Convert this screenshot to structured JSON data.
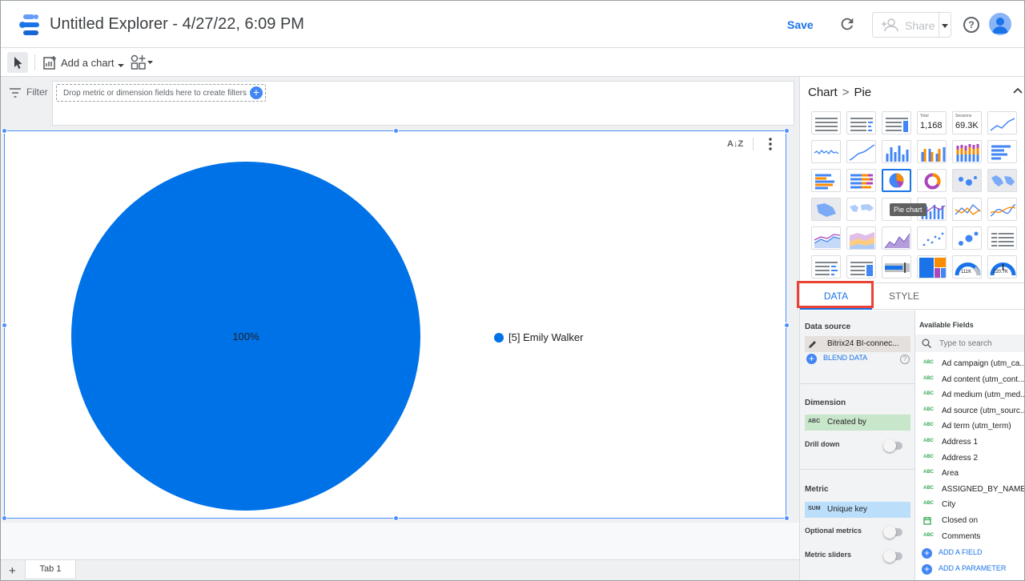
{
  "app": {
    "title": "Untitled Explorer - 4/27/22, 6:09 PM",
    "save_label": "Save",
    "share_label": "Share",
    "help_glyph": "?"
  },
  "toolbar": {
    "add_chart_label": "Add a chart"
  },
  "filter": {
    "label": "Filter",
    "placeholder": "Drop metric or dimension fields here to create filters"
  },
  "chart": {
    "sort_glyph": "A↓Z"
  },
  "chart_data": {
    "type": "pie",
    "slices": [
      {
        "label": "[5] Emily Walker",
        "value": 100,
        "display": "100%",
        "color": "#0072e8"
      }
    ]
  },
  "tabs": [
    {
      "label": "Tab 1"
    }
  ],
  "tab_add_glyph": "+",
  "panel": {
    "breadcrumb_root": "Chart",
    "breadcrumb_sep": ">",
    "breadcrumb_current": "Pie",
    "thumb_total_caption": "Total",
    "thumb_total_value": "1,168",
    "thumb_sessions_caption": "Sessions",
    "thumb_sessions_value": "69.3K",
    "thumb_gauge1_value": "111K",
    "thumb_gauge2_value": "220.7K",
    "tooltip": "Pie chart",
    "tab_data": "DATA",
    "tab_style": "STYLE",
    "data_source_label": "Data source",
    "data_source_value": "Bitrix24 BI-connec...",
    "blend_label": "BLEND DATA",
    "dimension_label": "Dimension",
    "dimension_tag": "ABC",
    "dimension_value": "Created by",
    "drill_down_label": "Drill down",
    "metric_label": "Metric",
    "metric_tag": "SUM",
    "metric_value": "Unique key",
    "optional_metrics_label": "Optional metrics",
    "metric_sliders_label": "Metric sliders",
    "available_fields_label": "Available Fields",
    "search_placeholder": "Type to search",
    "fields": [
      {
        "type": "ABC",
        "name": "Ad campaign (utm_ca..."
      },
      {
        "type": "ABC",
        "name": "Ad content (utm_cont..."
      },
      {
        "type": "ABC",
        "name": "Ad medium (utm_med..."
      },
      {
        "type": "ABC",
        "name": "Ad source (utm_sourc..."
      },
      {
        "type": "ABC",
        "name": "Ad term (utm_term)"
      },
      {
        "type": "ABC",
        "name": "Address 1"
      },
      {
        "type": "ABC",
        "name": "Address 2"
      },
      {
        "type": "ABC",
        "name": "Area"
      },
      {
        "type": "ABC",
        "name": "ASSIGNED_BY_NAME"
      },
      {
        "type": "ABC",
        "name": "City"
      },
      {
        "type": "calendar-icon",
        "name": "Closed on"
      },
      {
        "type": "ABC",
        "name": "Comments"
      }
    ],
    "add_field_label": "ADD A FIELD",
    "add_parameter_label": "ADD A PARAMETER"
  },
  "colors": {
    "accent": "#1a73e8",
    "pie": "#0072e8",
    "selection": "#4d90fe",
    "highlight_outline": "#ea4335"
  }
}
